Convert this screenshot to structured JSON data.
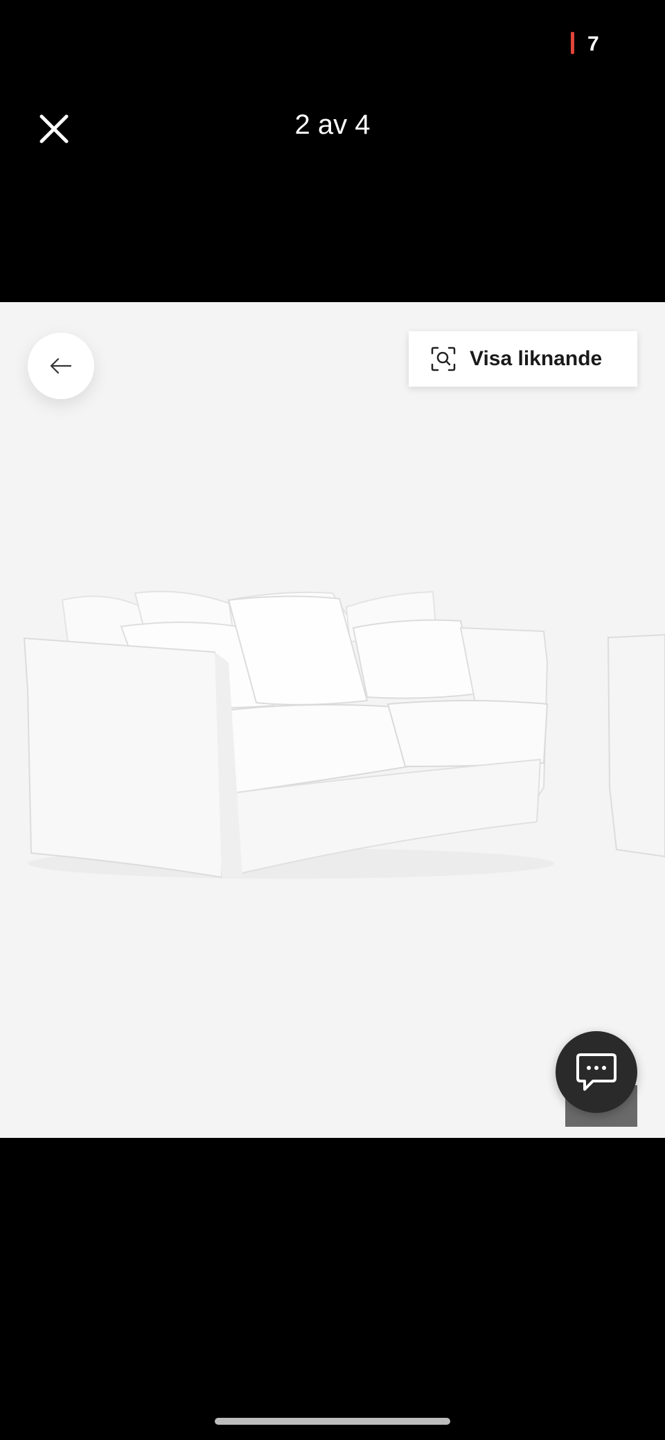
{
  "status_bar": {
    "battery_level": "7",
    "battery_color": "#e0453a"
  },
  "viewer": {
    "counter": "2 av 4",
    "close_icon": "close-icon"
  },
  "image": {
    "back_icon": "arrow-left-icon",
    "similar_label": "Visa liknande",
    "similar_icon": "visual-search-icon",
    "background": "#f4f4f4"
  },
  "chat": {
    "icon": "chat-bubble-icon",
    "background": "#2a2a2a"
  }
}
